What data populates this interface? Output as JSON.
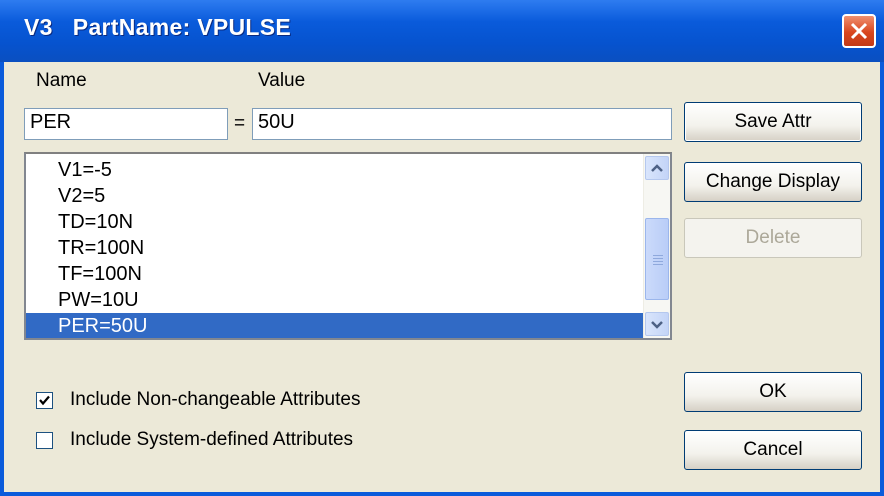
{
  "window": {
    "title": "V3   PartName: VPULSE"
  },
  "labels": {
    "name": "Name",
    "value": "Value",
    "equals": "="
  },
  "fields": {
    "name_value": "PER",
    "value_value": "50U"
  },
  "attributes": [
    {
      "text": "V1=-5",
      "selected": false
    },
    {
      "text": "V2=5",
      "selected": false
    },
    {
      "text": "TD=10N",
      "selected": false
    },
    {
      "text": "TR=100N",
      "selected": false
    },
    {
      "text": "TF=100N",
      "selected": false
    },
    {
      "text": "PW=10U",
      "selected": false
    },
    {
      "text": "PER=50U",
      "selected": true
    }
  ],
  "buttons": {
    "save_attr": "Save Attr",
    "change_display": "Change Display",
    "delete": "Delete",
    "ok": "OK",
    "cancel": "Cancel"
  },
  "checkboxes": {
    "non_changeable": {
      "label": "Include Non-changeable Attributes",
      "checked": true
    },
    "system_defined": {
      "label": "Include System-defined Attributes",
      "checked": false
    }
  },
  "colors": {
    "titlebar": "#0A5BDB",
    "selection": "#316AC5",
    "dialog_bg": "#ECE9D8"
  }
}
